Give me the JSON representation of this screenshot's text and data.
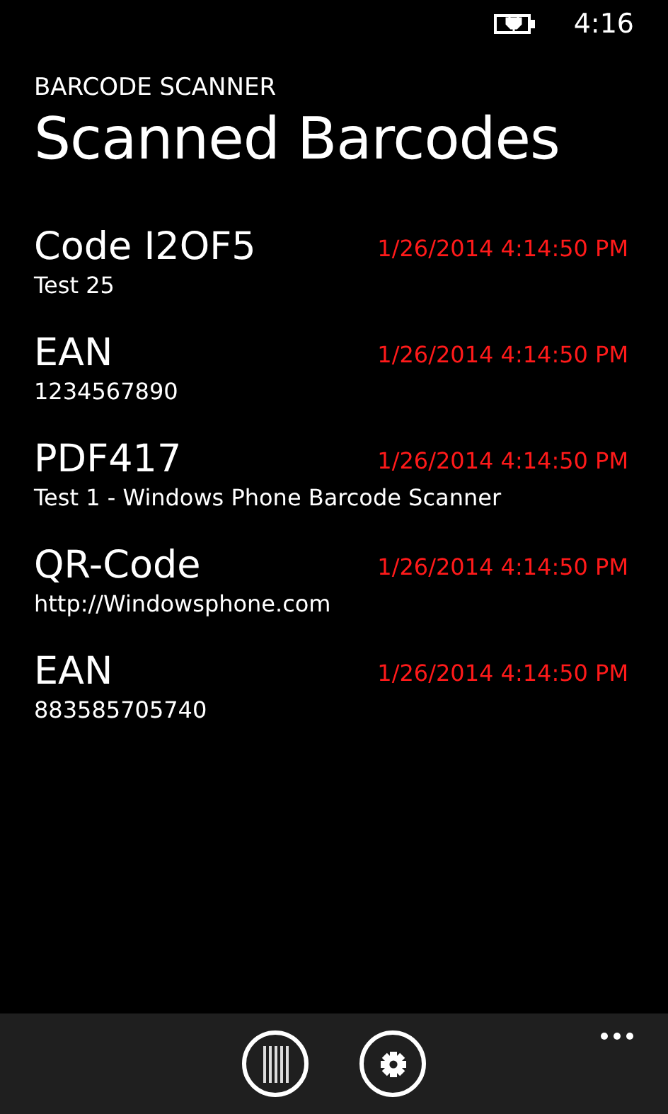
{
  "status_bar": {
    "time": "4:16"
  },
  "app_title": "BARCODE SCANNER",
  "page_title": "Scanned Barcodes",
  "items": [
    {
      "title": "Code I2OF5",
      "detail": "Test 25",
      "date": "1/26/2014 4:14:50 PM"
    },
    {
      "title": "EAN",
      "detail": "1234567890",
      "date": "1/26/2014 4:14:50 PM"
    },
    {
      "title": "PDF417",
      "detail": "Test 1 - Windows Phone Barcode Scanner",
      "date": "1/26/2014 4:14:50 PM"
    },
    {
      "title": "QR-Code",
      "detail": "http://Windowsphone.com",
      "date": "1/26/2014 4:14:50 PM"
    },
    {
      "title": "EAN",
      "detail": "883585705740",
      "date": "1/26/2014 4:14:50 PM"
    }
  ],
  "app_bar": {
    "buttons": [
      {
        "kind": "scan"
      },
      {
        "kind": "settings"
      }
    ]
  }
}
